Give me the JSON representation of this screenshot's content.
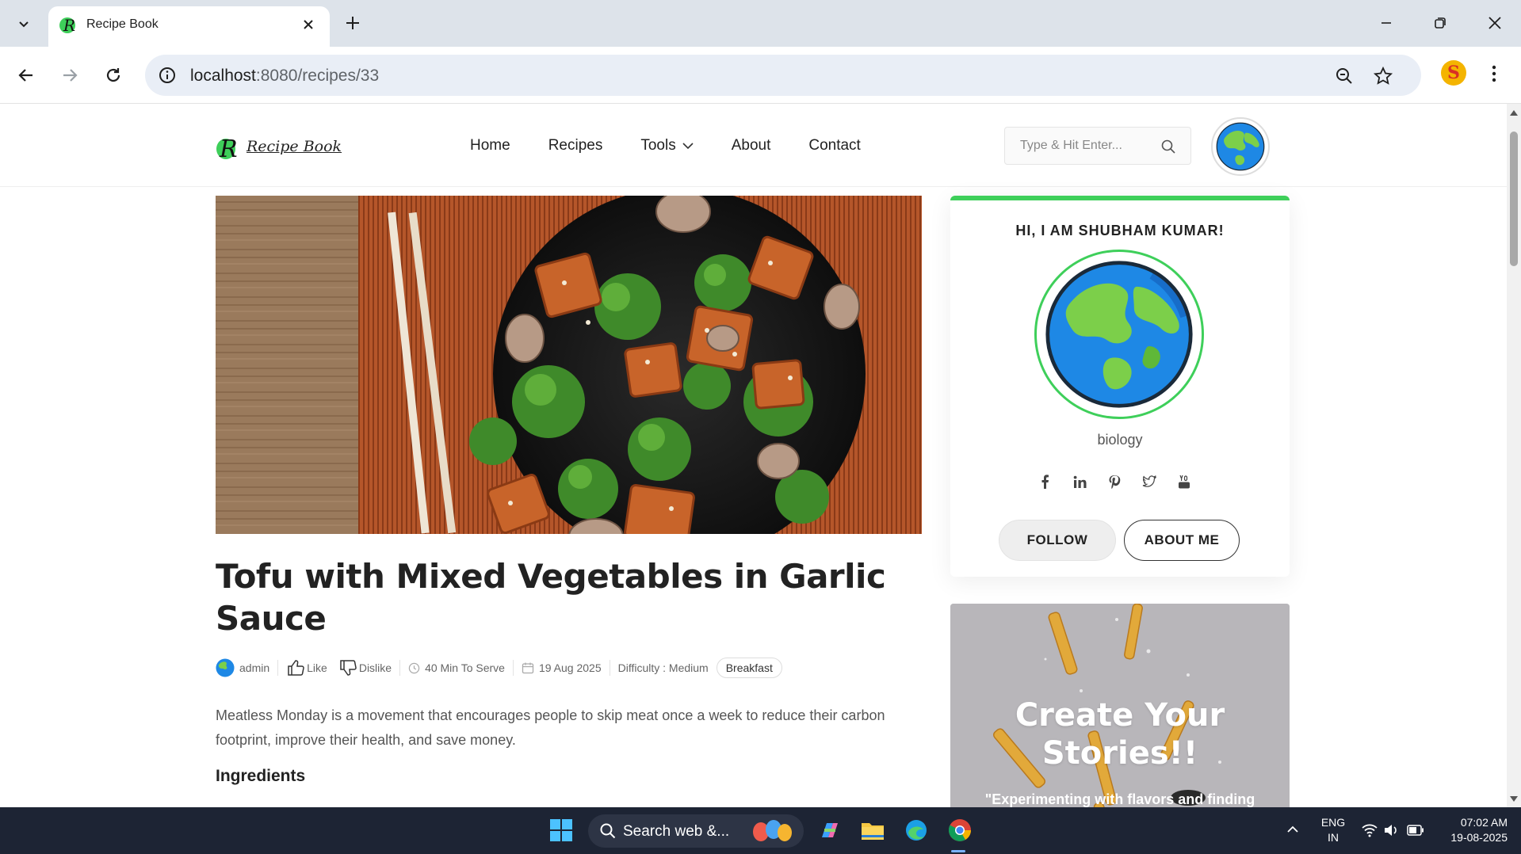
{
  "browser": {
    "tab_title": "Recipe Book",
    "url_host": "localhost",
    "url_rest": ":8080/recipes/33"
  },
  "site": {
    "logo_text": "Recipe Book",
    "nav": [
      "Home",
      "Recipes",
      "Tools",
      "About",
      "Contact"
    ],
    "search_placeholder": "Type & Hit Enter..."
  },
  "post": {
    "title": "Tofu with Mixed Vegetables in Garlic Sauce",
    "author": "admin",
    "like_label": "Like",
    "dislike_label": "Dislike",
    "serve_time": "40 Min To Serve",
    "date": "19 Aug 2025",
    "difficulty": "Difficulty : Medium",
    "category": "Breakfast",
    "intro": "Meatless Monday is a movement that encourages people to skip meat once a week to reduce their carbon footprint, improve their health, and save money.",
    "ingredients_heading": "Ingredients"
  },
  "sidebar": {
    "greeting": "HI, I AM SHUBHAM KUMAR!",
    "username": "biology",
    "social": [
      "facebook-icon",
      "linkedin-icon",
      "pinterest-icon",
      "twitter-icon",
      "youtube-icon"
    ],
    "follow_label": "FOLLOW",
    "about_label": "ABOUT ME",
    "promo_title": "Create Your Stories!!",
    "promo_quote": "\"Experimenting with flavors and finding"
  },
  "taskbar": {
    "search_text": "Search web &...",
    "lang_top": "ENG",
    "lang_bottom": "IN",
    "time": "07:02 AM",
    "date": "19-08-2025"
  },
  "colors": {
    "accent_green": "#3ecf5a",
    "taskbar_bg": "#1d2434",
    "omnibox_bg": "#e9eef6"
  }
}
